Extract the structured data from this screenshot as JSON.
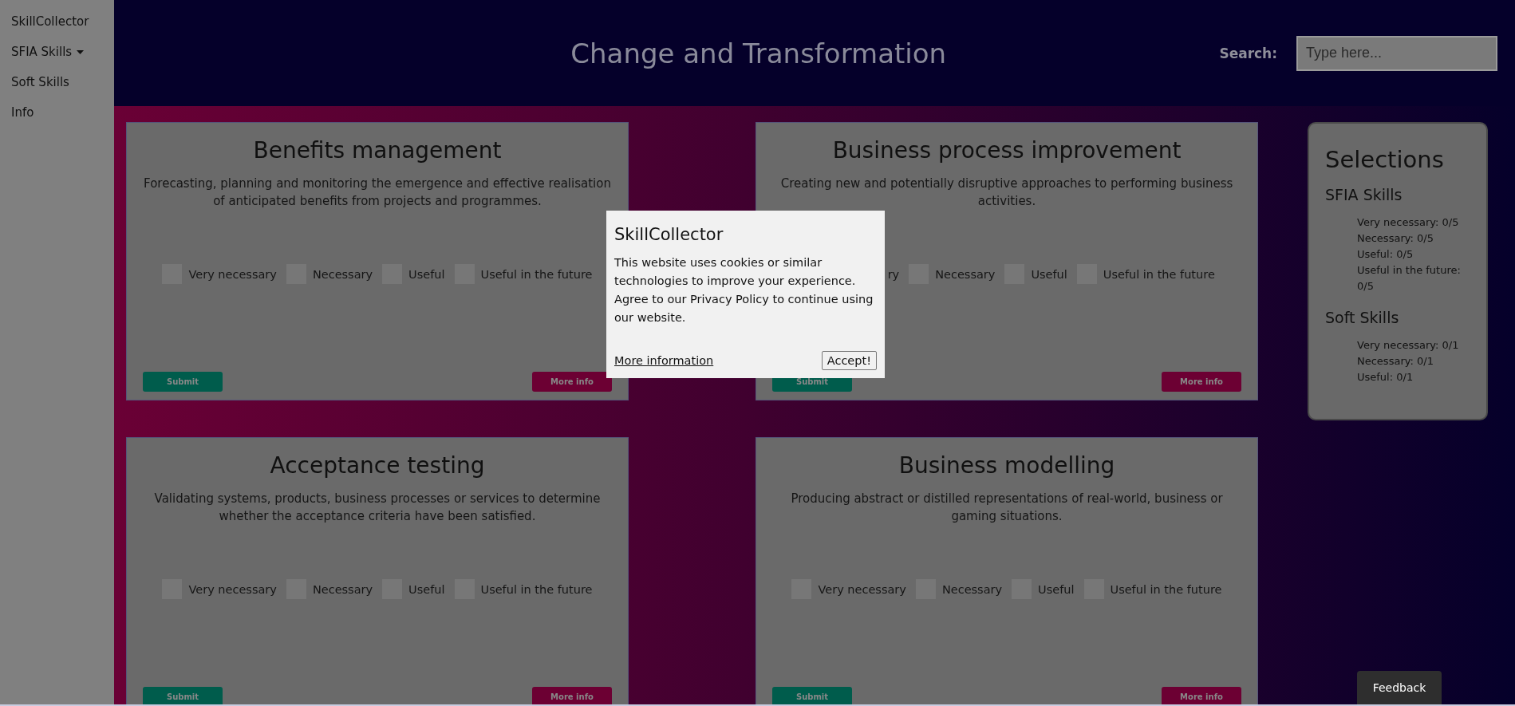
{
  "sidebar": {
    "items": [
      {
        "label": "SkillCollector",
        "kind": "brand"
      },
      {
        "label": "SFIA Skills",
        "kind": "dropdown"
      },
      {
        "label": "Soft Skills",
        "kind": "link"
      },
      {
        "label": "Info",
        "kind": "link"
      }
    ]
  },
  "header": {
    "title": "Change and Transformation",
    "search_label": "Search:",
    "search": {
      "placeholder": "Type here..."
    }
  },
  "cards": [
    {
      "title": "Benefits management",
      "description": "Forecasting, planning and monitoring the emergence and effective realisation of anticipated benefits from projects and programmes.",
      "options": [
        {
          "label": "Very necessary",
          "checked": false
        },
        {
          "label": "Necessary",
          "checked": false
        },
        {
          "label": "Useful",
          "checked": false
        },
        {
          "label": "Useful in the future",
          "checked": false
        }
      ],
      "submit": "Submit",
      "more": "More info"
    },
    {
      "title": "Business process improvement",
      "description": "Creating new and potentially disruptive approaches to performing business activities.",
      "options": [
        {
          "label": "ry"
        },
        {
          "label": "Necessary",
          "checked": false
        },
        {
          "label": "Useful",
          "checked": false
        },
        {
          "label": "Useful in the future",
          "checked": false
        }
      ],
      "submit": "Submit",
      "more": "More info"
    },
    {
      "title": "Acceptance testing",
      "description": "Validating systems, products, business processes or services to determine whether the acceptance criteria have been satisfied.",
      "options": [
        {
          "label": "Very necessary",
          "checked": false
        },
        {
          "label": "Necessary",
          "checked": false
        },
        {
          "label": "Useful",
          "checked": false
        },
        {
          "label": "Useful in the future",
          "checked": false
        }
      ],
      "submit": "Submit",
      "more": "More info"
    },
    {
      "title": "Business modelling",
      "description": "Producing abstract or distilled representations of real-world, business or gaming situations.",
      "options": [
        {
          "label": "Very necessary",
          "checked": false
        },
        {
          "label": "Necessary",
          "checked": false
        },
        {
          "label": "Useful",
          "checked": false
        },
        {
          "label": "Useful in the future",
          "checked": false
        }
      ],
      "submit": "Submit",
      "more": "More info"
    }
  ],
  "selections": {
    "title": "Selections",
    "groups": [
      {
        "title": "SFIA Skills",
        "lines": [
          "Very necessary: 0/5",
          "Necessary: 0/5",
          "Useful: 0/5",
          "Useful in the future: 0/5"
        ]
      },
      {
        "title": "Soft Skills",
        "lines": [
          "Very necessary: 0/1",
          "Necessary: 0/1",
          "Useful: 0/1"
        ]
      }
    ]
  },
  "cookie_dialog": {
    "title": "SkillCollector",
    "text": "This website uses cookies or similar technologies to improve your experience. Agree to our Privacy Policy to continue using our website.",
    "link": "More information",
    "button": "Accept!"
  },
  "feedback": "Feedback"
}
